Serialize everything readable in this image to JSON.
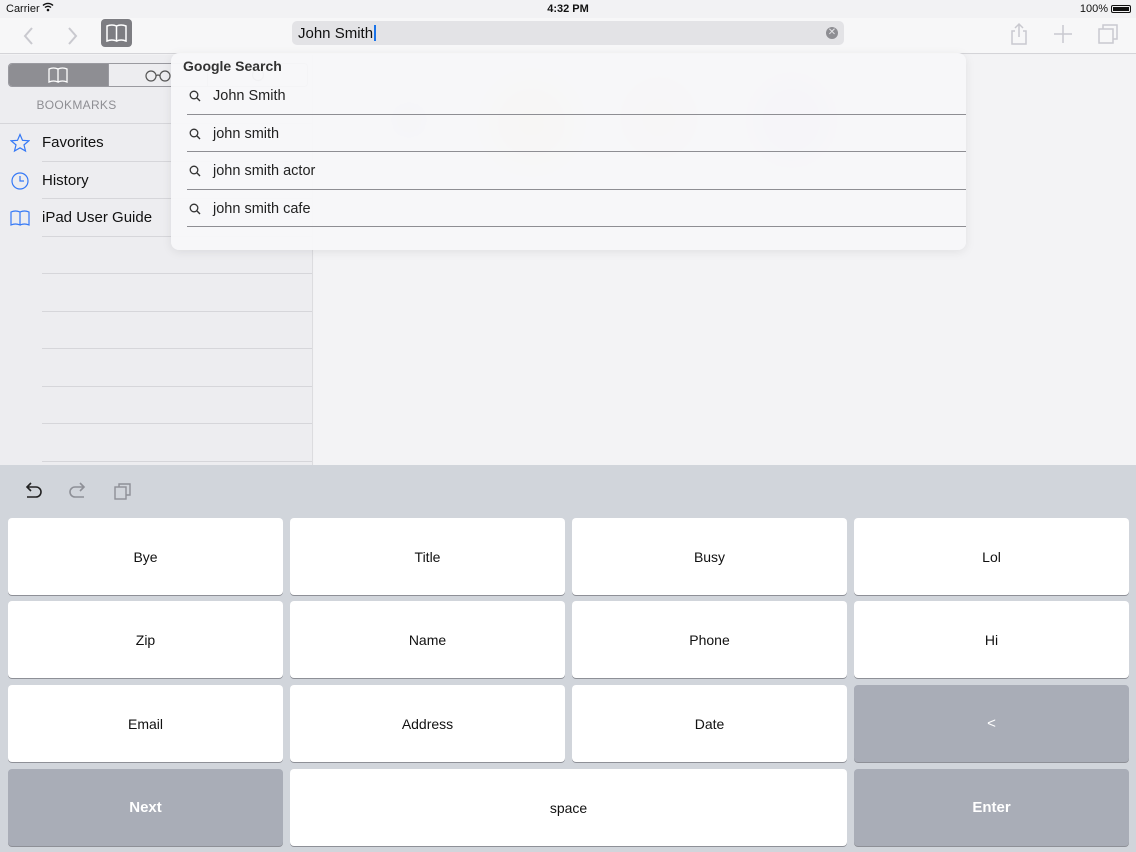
{
  "status_bar": {
    "carrier": "Carrier",
    "time": "4:32 PM",
    "battery": "100%"
  },
  "toolbar": {
    "url_text": "John Smith"
  },
  "sidebar": {
    "header": "BOOKMARKS",
    "items": [
      {
        "label": "Favorites",
        "icon": "star-icon"
      },
      {
        "label": "History",
        "icon": "clock-icon"
      },
      {
        "label": "iPad User Guide",
        "icon": "book-icon"
      }
    ]
  },
  "suggestions": {
    "title": "Google Search",
    "items": [
      "John Smith",
      "john smith",
      "john smith actor",
      "john smith cafe"
    ]
  },
  "keyboard": {
    "rows": [
      [
        "Bye",
        "Title",
        "Busy",
        "Lol"
      ],
      [
        "Zip",
        "Name",
        "Phone",
        "Hi"
      ],
      [
        "Email",
        "Address",
        "Date",
        "<"
      ],
      [
        "Next",
        "space",
        "Enter"
      ]
    ]
  },
  "colors": {
    "accent": "#1a73e8",
    "icon_blue": "#3478f6",
    "dark_key": "#a9adb7",
    "keyboard_bg": "#d1d5db"
  }
}
